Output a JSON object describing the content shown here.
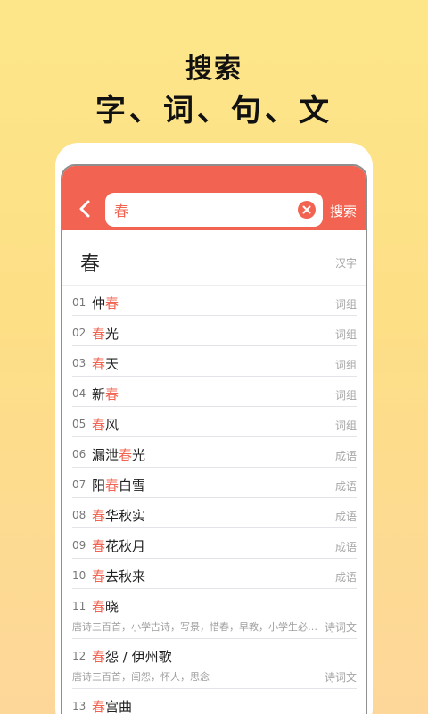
{
  "headline": {
    "line1": "搜索",
    "line2": "字、词、句、文"
  },
  "topbar": {
    "back_icon": "chevron-left-icon",
    "search_value": "春",
    "clear_icon": "clear-circle-icon",
    "search_label": "搜索"
  },
  "colors": {
    "accent": "#f26451",
    "background": "#fde68a"
  },
  "main": {
    "char": "春",
    "tag": "汉字"
  },
  "results": [
    {
      "num": "01",
      "parts": [
        {
          "t": "仲",
          "h": false
        },
        {
          "t": "春",
          "h": true
        }
      ],
      "tag": "词组"
    },
    {
      "num": "02",
      "parts": [
        {
          "t": "春",
          "h": true
        },
        {
          "t": "光",
          "h": false
        }
      ],
      "tag": "词组"
    },
    {
      "num": "03",
      "parts": [
        {
          "t": "春",
          "h": true
        },
        {
          "t": "天",
          "h": false
        }
      ],
      "tag": "词组"
    },
    {
      "num": "04",
      "parts": [
        {
          "t": "新",
          "h": false
        },
        {
          "t": "春",
          "h": true
        }
      ],
      "tag": "词组"
    },
    {
      "num": "05",
      "parts": [
        {
          "t": "春",
          "h": true
        },
        {
          "t": "风",
          "h": false
        }
      ],
      "tag": "词组"
    },
    {
      "num": "06",
      "parts": [
        {
          "t": "漏泄",
          "h": false
        },
        {
          "t": "春",
          "h": true
        },
        {
          "t": "光",
          "h": false
        }
      ],
      "tag": "成语"
    },
    {
      "num": "07",
      "parts": [
        {
          "t": "阳",
          "h": false
        },
        {
          "t": "春",
          "h": true
        },
        {
          "t": "白雪",
          "h": false
        }
      ],
      "tag": "成语"
    },
    {
      "num": "08",
      "parts": [
        {
          "t": "春",
          "h": true
        },
        {
          "t": "华秋实",
          "h": false
        }
      ],
      "tag": "成语"
    },
    {
      "num": "09",
      "parts": [
        {
          "t": "春",
          "h": true
        },
        {
          "t": "花秋月",
          "h": false
        }
      ],
      "tag": "成语"
    },
    {
      "num": "10",
      "parts": [
        {
          "t": "春",
          "h": true
        },
        {
          "t": "去秋来",
          "h": false
        }
      ],
      "tag": "成语"
    },
    {
      "num": "11",
      "parts": [
        {
          "t": "春",
          "h": true
        },
        {
          "t": "晓",
          "h": false
        }
      ],
      "sub": "唐诗三百首，小学古诗，写景，惜春，早教，小学生必…",
      "tag": "诗词文"
    },
    {
      "num": "12",
      "parts": [
        {
          "t": "春",
          "h": true
        },
        {
          "t": "怨 / 伊州歌",
          "h": false
        }
      ],
      "sub": "唐诗三百首，闺怨，怀人，思念",
      "tag": "诗词文"
    },
    {
      "num": "13",
      "parts": [
        {
          "t": "春",
          "h": true
        },
        {
          "t": "宫曲",
          "h": false
        }
      ],
      "tag": ""
    }
  ]
}
